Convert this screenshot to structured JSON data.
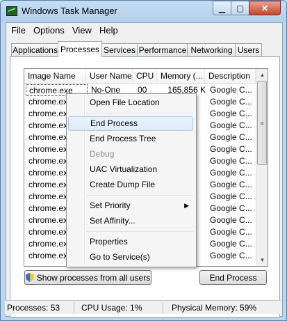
{
  "window": {
    "title": "Windows Task Manager",
    "min_glyph": "▁",
    "max_glyph": "▢",
    "close_glyph": "✕"
  },
  "menubar": [
    "File",
    "Options",
    "View",
    "Help"
  ],
  "tabs": [
    "Applications",
    "Processes",
    "Services",
    "Performance",
    "Networking",
    "Users"
  ],
  "active_tab": "Processes",
  "process_table": {
    "columns": [
      "Image Name",
      "User Name",
      "CPU",
      "Memory (...",
      "Description"
    ],
    "sort_glyph": "▲",
    "rows": [
      [
        "chrome.exe",
        "No-One",
        "00",
        "165,856 K",
        "Google C..."
      ],
      [
        "chrome.exe",
        "",
        "",
        "",
        "Google C..."
      ],
      [
        "chrome.exe",
        "",
        "",
        "",
        "Google C..."
      ],
      [
        "chrome.exe",
        "",
        "",
        "",
        "Google C..."
      ],
      [
        "chrome.exe",
        "",
        "",
        "",
        "Google C..."
      ],
      [
        "chrome.exe",
        "",
        "",
        "",
        "Google C..."
      ],
      [
        "chrome.exe",
        "",
        "",
        "",
        "Google C..."
      ],
      [
        "chrome.exe",
        "",
        "",
        "",
        "Google C..."
      ],
      [
        "chrome.exe",
        "",
        "",
        "",
        "Google C..."
      ],
      [
        "chrome.exe",
        "",
        "",
        "",
        "Google C..."
      ],
      [
        "chrome.exe",
        "",
        "",
        "",
        "Google C..."
      ],
      [
        "chrome.exe",
        "",
        "",
        "",
        "Google C..."
      ],
      [
        "chrome.exe",
        "",
        "",
        "",
        "Google C..."
      ],
      [
        "chrome.exe",
        "",
        "",
        "",
        "Google C..."
      ],
      [
        "chrome.exe",
        "",
        "",
        "",
        "Google C..."
      ]
    ],
    "selected_row": 0
  },
  "scrollbar": {
    "up": "▲",
    "down": "▼",
    "grip": "≡"
  },
  "buttons": {
    "show_all": "Show processes from all users",
    "end_process": "End Process"
  },
  "status": {
    "processes": "Processes: 53",
    "cpu": "CPU Usage: 1%",
    "memory": "Physical Memory: 59%"
  },
  "context_menu": {
    "items": [
      {
        "label": "Open File Location",
        "state": "normal"
      },
      {
        "type": "separator"
      },
      {
        "label": "End Process",
        "state": "highlighted"
      },
      {
        "label": "End Process Tree",
        "state": "normal"
      },
      {
        "label": "Debug",
        "state": "disabled"
      },
      {
        "label": "UAC Virtualization",
        "state": "normal"
      },
      {
        "label": "Create Dump File",
        "state": "normal"
      },
      {
        "type": "separator"
      },
      {
        "label": "Set Priority",
        "state": "normal",
        "submenu": true,
        "submenu_glyph": "▶"
      },
      {
        "label": "Set Affinity...",
        "state": "normal"
      },
      {
        "type": "separator"
      },
      {
        "label": "Properties",
        "state": "normal"
      },
      {
        "label": "Go to Service(s)",
        "state": "normal"
      }
    ]
  },
  "colors": {
    "selection_border": "#a8c8ec",
    "disabled_text": "#8d8d8d",
    "close_button": "#c9452c"
  }
}
